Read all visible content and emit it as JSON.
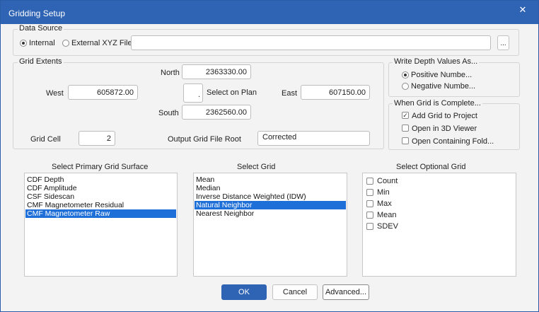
{
  "window": {
    "title": "Gridding Setup",
    "close_glyph": "✕"
  },
  "data_source": {
    "label": "Data Source",
    "internal_label": "Internal",
    "internal_selected": true,
    "external_label": "External XYZ File",
    "external_selected": false,
    "file_path": "",
    "browse_label": "..."
  },
  "grid_extents": {
    "label": "Grid Extents",
    "north_label": "North",
    "north_value": "2363330.00",
    "west_label": "West",
    "west_value": "605872.00",
    "east_label": "East",
    "east_value": "607150.00",
    "south_label": "South",
    "south_value": "2362560.00",
    "select_on_plan_label": "Select on Plan",
    "select_on_plan_glyph": ".",
    "grid_cell_label": "Grid Cell",
    "grid_cell_value": "2",
    "output_root_label": "Output Grid File Root",
    "output_root_value": "Corrected"
  },
  "write_depth": {
    "label": "Write Depth Values As...",
    "options": [
      {
        "label": "Positive Numbe...",
        "selected": true
      },
      {
        "label": "Negative Numbe...",
        "selected": false
      }
    ]
  },
  "when_complete": {
    "label": "When Grid is Complete...",
    "options": [
      {
        "label": "Add Grid to Project",
        "checked": true
      },
      {
        "label": "Open in 3D Viewer",
        "checked": false
      },
      {
        "label": "Open Containing Fold...",
        "checked": false
      }
    ],
    "check_glyph": "✓"
  },
  "primary_surface": {
    "label": "Select Primary Grid Surface",
    "items": [
      "CDF Depth",
      "CDF Amplitude",
      "CSF Sidescan",
      "CMF Magnetometer Residual",
      "CMF Magnetometer Raw"
    ],
    "selected_index": 4
  },
  "select_grid": {
    "label": "Select Grid",
    "items": [
      "Mean",
      "Median",
      "Inverse Distance Weighted (IDW)",
      "Natural Neighbor",
      "Nearest Neighbor"
    ],
    "selected_index": 3
  },
  "optional_grid": {
    "label": "Select Optional Grid",
    "items": [
      {
        "label": "Count",
        "checked": false
      },
      {
        "label": "Min",
        "checked": false
      },
      {
        "label": "Max",
        "checked": false
      },
      {
        "label": "Mean",
        "checked": false
      },
      {
        "label": "SDEV",
        "checked": false
      }
    ]
  },
  "buttons": {
    "ok": "OK",
    "cancel": "Cancel",
    "advanced": "Advanced..."
  },
  "colors": {
    "accent": "#2f63b4",
    "selection": "#1f6fd8"
  }
}
